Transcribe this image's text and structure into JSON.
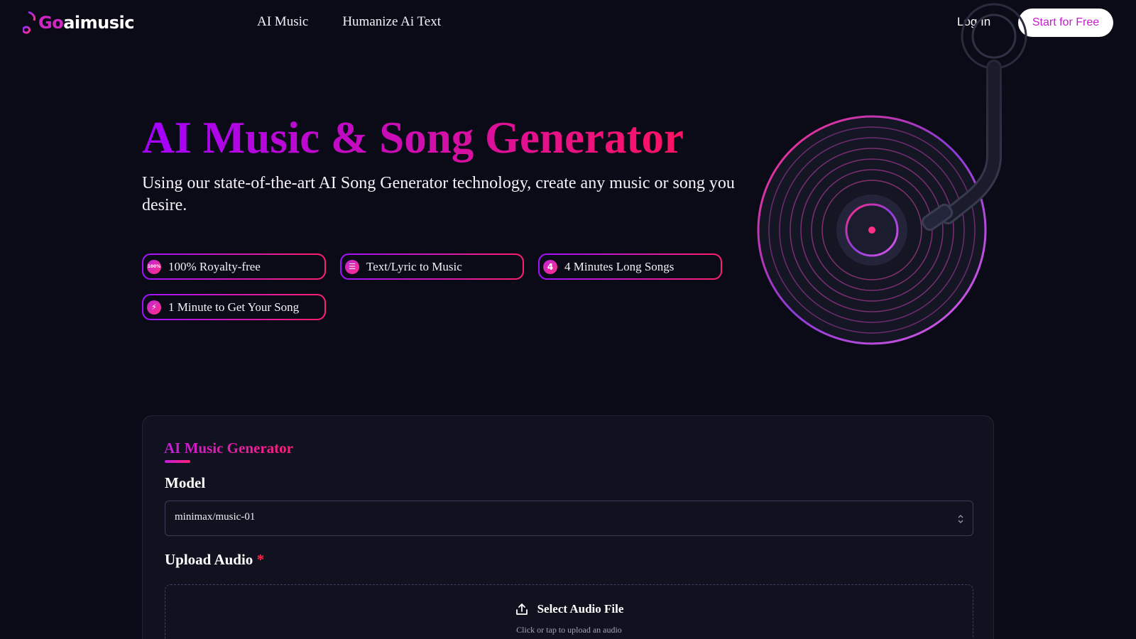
{
  "header": {
    "logo": {
      "prefix": "Go",
      "suffix": "aimusic"
    },
    "nav": [
      {
        "label": "AI Music"
      },
      {
        "label": "Humanize Ai Text"
      }
    ],
    "login_label": "Log In",
    "cta_label": "Start for Free"
  },
  "hero": {
    "title": "AI Music & Song Generator",
    "subtitle": "Using our state-of-the-art AI Song Generator technology, create any music or song you desire.",
    "features": [
      {
        "label": "100% Royalty-free",
        "icon": "percent-badge-icon",
        "icon_text": "100%"
      },
      {
        "label": "Text/Lyric to Music",
        "icon": "lines-icon",
        "icon_text": "☰"
      },
      {
        "label": "4 Minutes Long Songs",
        "icon": "four-minutes-icon",
        "icon_text": "4"
      },
      {
        "label": "1 Minute to Get Your Song",
        "icon": "lightning-icon",
        "icon_text": "⚡"
      }
    ]
  },
  "generator": {
    "title": "AI Music Generator",
    "model_label": "Model",
    "model_value": "minimax/music-01",
    "upload_label": "Upload Audio",
    "required_mark": "*",
    "upload_button": "Select Audio File",
    "upload_hint": "Click or tap to upload an audio"
  },
  "colors": {
    "background": "#0b0b18",
    "accent_purple": "#a300ff",
    "accent_pink": "#ff1361",
    "panel": "#11121f"
  }
}
